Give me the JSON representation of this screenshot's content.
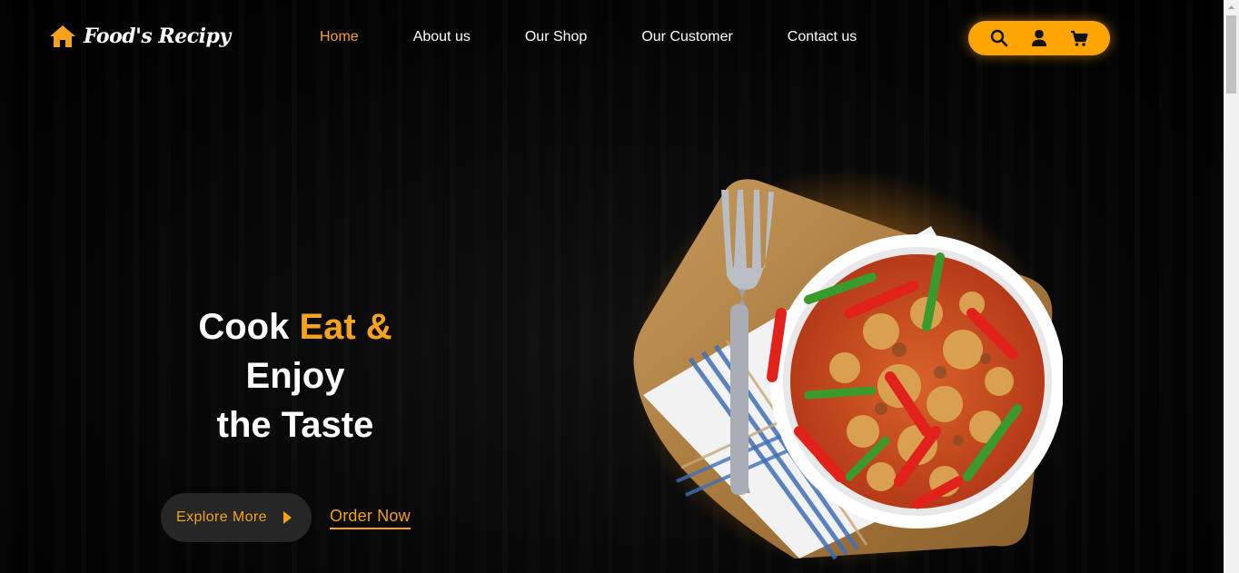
{
  "brand": {
    "name": "Food's Recipy",
    "icon": "home-icon"
  },
  "nav": {
    "items": [
      {
        "label": "Home",
        "active": true
      },
      {
        "label": "About us",
        "active": false
      },
      {
        "label": "Our Shop",
        "active": false
      },
      {
        "label": "Our Customer",
        "active": false
      },
      {
        "label": "Contact us",
        "active": false
      }
    ]
  },
  "toolbar": {
    "icons": [
      "search-icon",
      "user-icon",
      "cart-icon"
    ],
    "background": "#ffa500"
  },
  "hero": {
    "title_line1_a": "Cook ",
    "title_line1_b": "Eat &",
    "title_line2": "Enjoy",
    "title_line3": "the Taste",
    "explore_label": "Explore More",
    "order_label": "Order Now",
    "image": "food-dish-image"
  },
  "colors": {
    "accent": "#f7a21b",
    "background": "#000000",
    "button_dark": "#262626"
  }
}
